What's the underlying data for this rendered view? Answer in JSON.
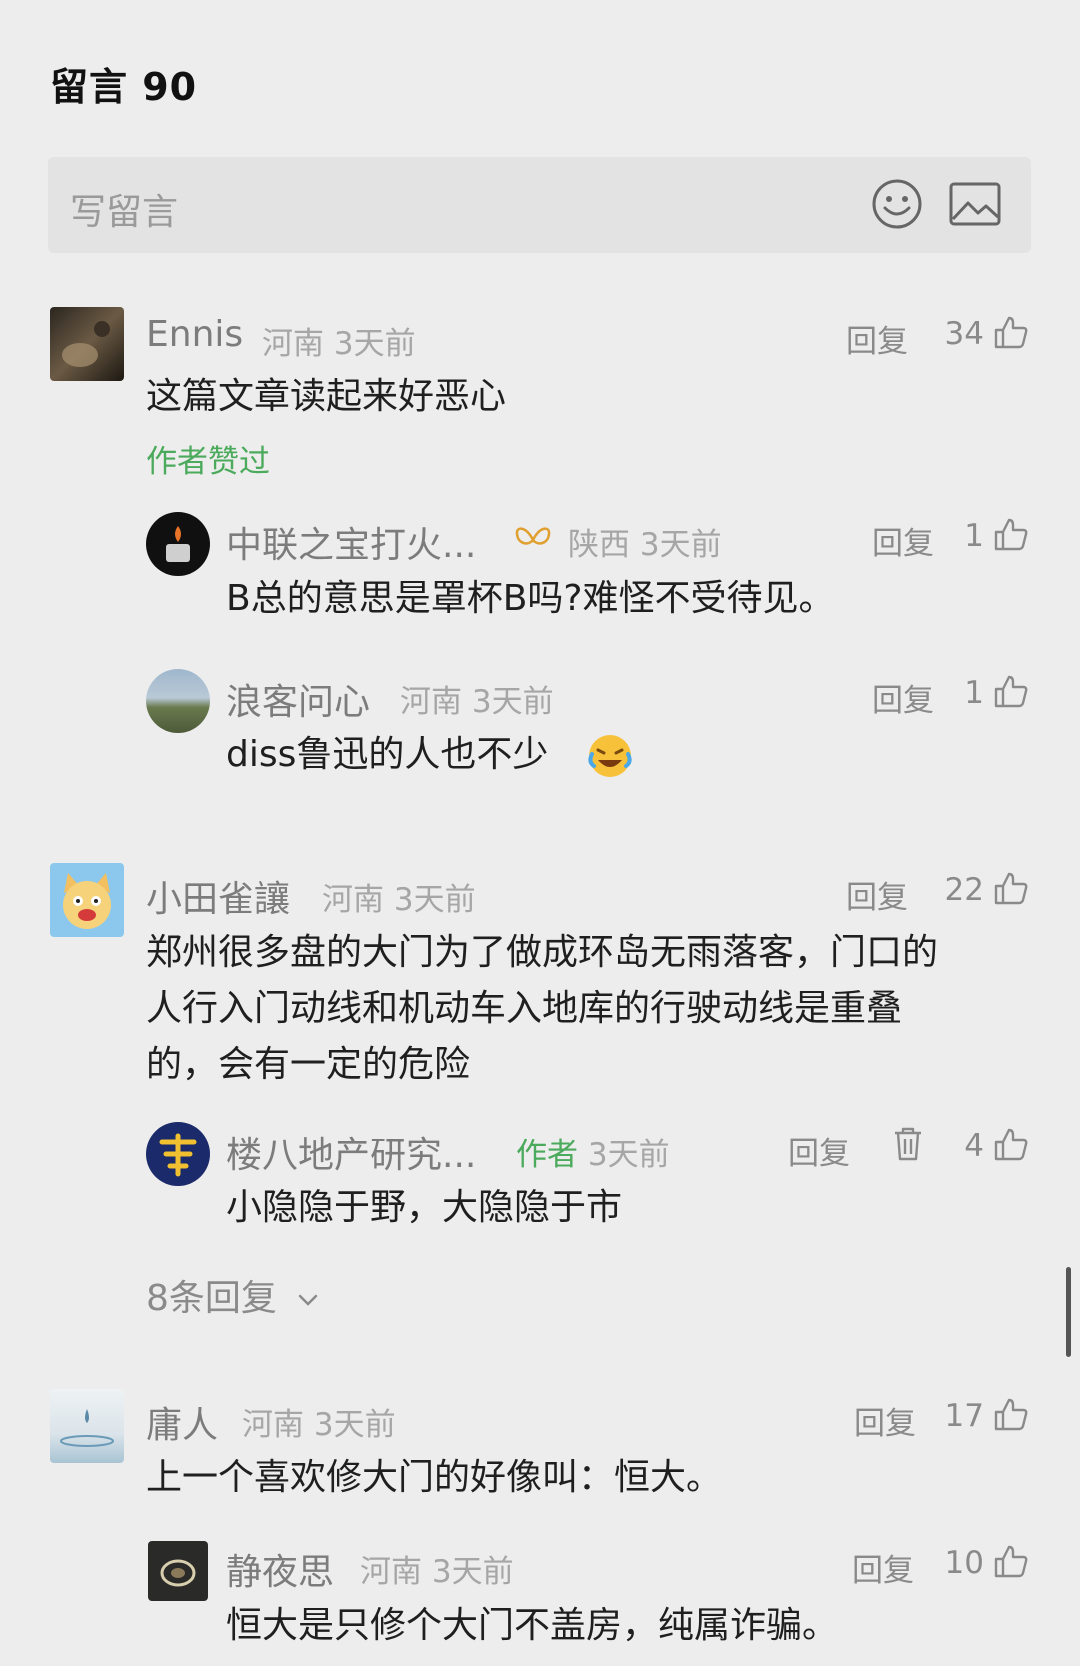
{
  "header": {
    "title": "留言 90"
  },
  "input": {
    "placeholder": "写留言",
    "emoji_icon": "emoji-smile-icon",
    "image_icon": "image-icon"
  },
  "reply_label": "回复",
  "comments": [
    {
      "name": "Ennis",
      "location": "河南",
      "time": "3天前",
      "likes": "34",
      "text": "这篇文章读起来好恶心",
      "liked_by_author": "作者赞过",
      "replies": [
        {
          "name": "中联之宝打火...",
          "location": "陕西",
          "time": "3天前",
          "likes": "1",
          "text": "B总的意思是罩杯B吗?难怪不受待见。"
        },
        {
          "name": "浪客问心",
          "location": "河南",
          "time": "3天前",
          "likes": "1",
          "text": "diss鲁迅的人也不少"
        }
      ]
    },
    {
      "name": "小田雀讓",
      "location": "河南",
      "time": "3天前",
      "likes": "22",
      "text_lines": [
        "郑州很多盘的大门为了做成环岛无雨落客，门口的",
        "人行入门动线和机动车入地库的行驶动线是重叠",
        "的，会有一定的危险"
      ],
      "replies": [
        {
          "name": "楼八地产研究...",
          "author_tag": "作者",
          "time": "3天前",
          "likes": "4",
          "text": "小隐隐于野，大隐隐于市"
        }
      ],
      "more_replies": "8条回复"
    },
    {
      "name": "庸人",
      "location": "河南",
      "time": "3天前",
      "likes": "17",
      "text": "上一个喜欢修大门的好像叫：恒大。",
      "replies": [
        {
          "name": "静夜思",
          "location": "河南",
          "time": "3天前",
          "likes": "10",
          "text": "恒大是只修个大门不盖房，纯属诈骗。"
        }
      ]
    }
  ]
}
